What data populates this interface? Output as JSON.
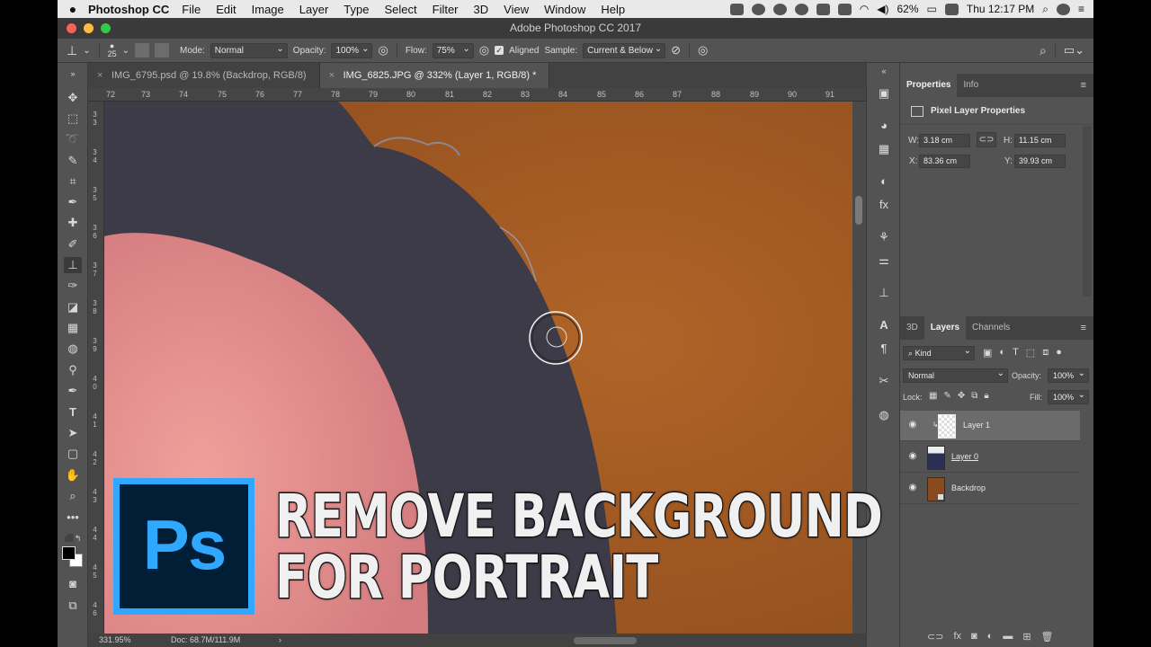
{
  "menubar": {
    "app": "Photoshop CC",
    "items": [
      "File",
      "Edit",
      "Image",
      "Layer",
      "Type",
      "Select",
      "Filter",
      "3D",
      "View",
      "Window",
      "Help"
    ],
    "battery": "62%",
    "clock": "Thu 12:17 PM"
  },
  "window": {
    "title": "Adobe Photoshop CC 2017"
  },
  "options": {
    "brush_size": "25",
    "mode_label": "Mode:",
    "mode_value": "Normal",
    "opacity_label": "Opacity:",
    "opacity_value": "100%",
    "flow_label": "Flow:",
    "flow_value": "75%",
    "aligned_label": "Aligned",
    "sample_label": "Sample:",
    "sample_value": "Current & Below"
  },
  "tabs": [
    {
      "label": "IMG_6795.psd @ 19.8% (Backdrop, RGB/8)"
    },
    {
      "label": "IMG_6825.JPG @ 332% (Layer 1, RGB/8) *"
    }
  ],
  "ruler": {
    "top_ticks": [
      "72",
      "73",
      "74",
      "75",
      "76",
      "77",
      "78",
      "79",
      "80",
      "81",
      "82",
      "83",
      "84",
      "85",
      "86",
      "87",
      "88",
      "89",
      "90",
      "91"
    ],
    "left_ticks": [
      "3 3",
      "3 4",
      "3 5",
      "3 6",
      "3 7",
      "3 8",
      "3 9",
      "4 0",
      "4 1",
      "4 2",
      "4 3",
      "4 4",
      "4 5",
      "4 6"
    ]
  },
  "status": {
    "zoom": "331.95%",
    "doc": "Doc: 68.7M/111.9M"
  },
  "properties": {
    "tabs": [
      "Properties",
      "Info"
    ],
    "header": "Pixel Layer Properties",
    "w_label": "W:",
    "w_value": "3.18 cm",
    "h_label": "H:",
    "h_value": "11.15 cm",
    "x_label": "X:",
    "x_value": "83.36 cm",
    "y_label": "Y:",
    "y_value": "39.93 cm"
  },
  "layers": {
    "tabs": [
      "3D",
      "Layers",
      "Channels"
    ],
    "kind_label": "Kind",
    "blend_mode": "Normal",
    "opacity_label": "Opacity:",
    "opacity_value": "100%",
    "lock_label": "Lock:",
    "fill_label": "Fill:",
    "fill_value": "100%",
    "rows": [
      {
        "name": "Layer 1",
        "selected": true
      },
      {
        "name": "Layer 0",
        "selected": false
      },
      {
        "name": "Backdrop",
        "selected": false
      }
    ]
  },
  "overlay": {
    "logo_text": "Ps",
    "line1": "REMOVE BACKGROUND",
    "line2": "FOR PORTRAIT"
  },
  "colors": {
    "ps_blue": "#31a8ff",
    "ps_navy": "#001e36",
    "backdrop": "#a75d22",
    "hair": "#3d3b48",
    "skin": "#e48e8f"
  }
}
